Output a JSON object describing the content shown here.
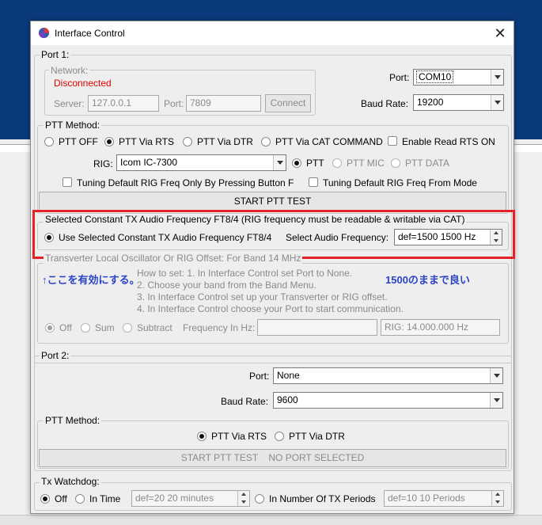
{
  "window": {
    "title": "Interface Control",
    "close_symbol": "✕"
  },
  "port1": {
    "label": "Port 1:",
    "network": {
      "label": "Network:",
      "status": "Disconnected",
      "status_color": "#e00000",
      "server_label": "Server:",
      "server_value": "127.0.0.1",
      "port_label": "Port:",
      "port_value": "7809",
      "connect_label": "Connect"
    },
    "port_label": "Port:",
    "port_value": "COM10",
    "baud_label": "Baud Rate:",
    "baud_value": "19200",
    "ptt_method": {
      "label": "PTT Method:",
      "options": [
        "PTT OFF",
        "PTT Via RTS",
        "PTT Via DTR",
        "PTT Via CAT COMMAND"
      ],
      "selected": "PTT Via RTS",
      "enable_rts_label": "Enable Read RTS ON",
      "rig_label": "RIG:",
      "rig_value": "Icom IC-7300",
      "ptt_types": [
        "PTT",
        "PTT MIC",
        "PTT DATA"
      ],
      "tuning_button_label": "Tuning Default RIG Freq Only By Pressing Button F",
      "tuning_mode_label": "Tuning Default RIG Freq From Mode",
      "start_test_label": "START PTT TEST"
    },
    "constant_tx": {
      "label": "Selected Constant TX Audio Frequency FT8/4 (RIG frequency must be readable & writable via CAT)",
      "use_label": "Use Selected Constant TX Audio Frequency FT8/4",
      "select_label": "Select Audio Frequency:",
      "spinner_value": "def=1500  1500  Hz"
    },
    "transverter": {
      "label": "Transverter Local Oscillator Or RIG Offset:  For Band 14 MHz",
      "howto": [
        "How to set: 1. In Interface Control set Port to None.",
        "2. Choose your band from the Band Menu.",
        "3. In Interface Control set up your Transverter or RIG offset.",
        "4. In Interface Control choose your Port to start communication."
      ],
      "options": [
        "Off",
        "Sum",
        "Subtract"
      ],
      "freq_label": "Frequency In Hz:",
      "freq_value": "",
      "rig_freq": "RIG: 14.000.000 Hz"
    }
  },
  "annotations": {
    "note_left": "↑ここを有効にする。",
    "note_right": "1500のままで良い",
    "highlight_color": "#e8202a",
    "note_color": "#2a44c6"
  },
  "port2": {
    "label": "Port 2:",
    "port_label": "Port:",
    "port_value": "None",
    "baud_label": "Baud Rate:",
    "baud_value": "9600",
    "ptt_label": "PTT Method:",
    "ptt_options": [
      "PTT Via RTS",
      "PTT Via DTR"
    ],
    "selected": "PTT Via RTS",
    "start_test_label": "START PTT TEST    NO PORT SELECTED"
  },
  "watchdog": {
    "label": "Tx Watchdog:",
    "off_label": "Off",
    "in_time_label": "In Time",
    "time_value": "def=20  20  minutes",
    "periods_label": "In Number Of TX Periods",
    "periods_value": "def=10  10  Periods"
  }
}
